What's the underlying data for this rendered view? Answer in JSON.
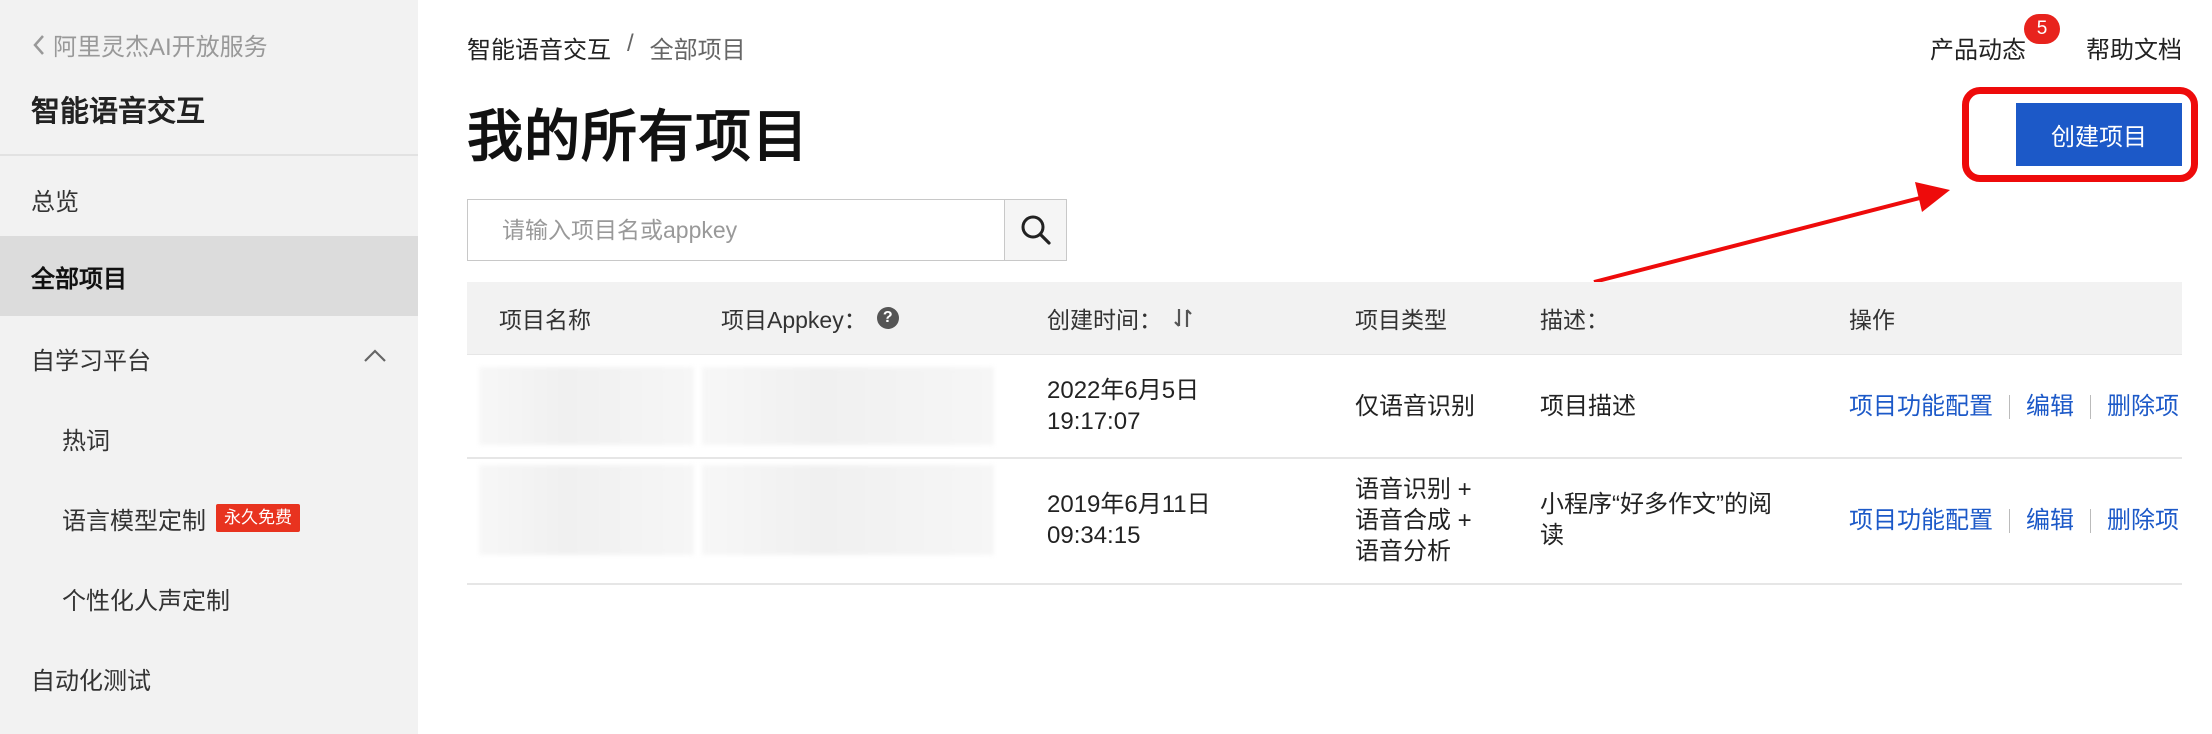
{
  "sidebar": {
    "back_label": "阿里灵杰AI开放服务",
    "product_title": "智能语音交互",
    "items": [
      {
        "label": "总览"
      },
      {
        "label": "全部项目"
      },
      {
        "label": "自学习平台"
      },
      {
        "label": "热词"
      },
      {
        "label": "语言模型定制",
        "badge": "永久免费"
      },
      {
        "label": "个性化人声定制"
      },
      {
        "label": "自动化测试"
      }
    ],
    "active_item": "全部项目"
  },
  "breadcrumb": {
    "root": "智能语音交互",
    "separator": "/",
    "current": "全部项目"
  },
  "header": {
    "news_label": "产品动态",
    "news_count": "5",
    "help_label": "帮助文档"
  },
  "page": {
    "title": "我的所有项目",
    "create_button": "创建项目"
  },
  "search": {
    "placeholder": "请输入项目名或appkey",
    "value": ""
  },
  "table": {
    "columns": [
      "项目名称",
      "项目Appkey：",
      "创建时间：",
      "项目类型",
      "描述：",
      "操作"
    ],
    "rows": [
      {
        "name": "",
        "appkey": "",
        "created_date": "2022年6月5日",
        "created_time": "19:17:07",
        "type_lines": [
          "仅语音识别"
        ],
        "desc_lines": [
          "项目描述"
        ]
      },
      {
        "name": "",
        "appkey": "",
        "created_date": "2019年6月11日",
        "created_time": "09:34:15",
        "type_lines": [
          "语音识别 +",
          "语音合成 +",
          "语音分析"
        ],
        "desc_lines": [
          "小程序“好多作文”的阅",
          "读"
        ]
      }
    ],
    "actions": [
      "项目功能配置",
      "编辑",
      "删除项"
    ]
  },
  "colors": {
    "primary": "#1c59c8",
    "highlight": "#ee0b0b",
    "badge": "#e8331f",
    "sidebar_bg": "#f2f2f2",
    "sidebar_active": "#dcdcdc"
  }
}
